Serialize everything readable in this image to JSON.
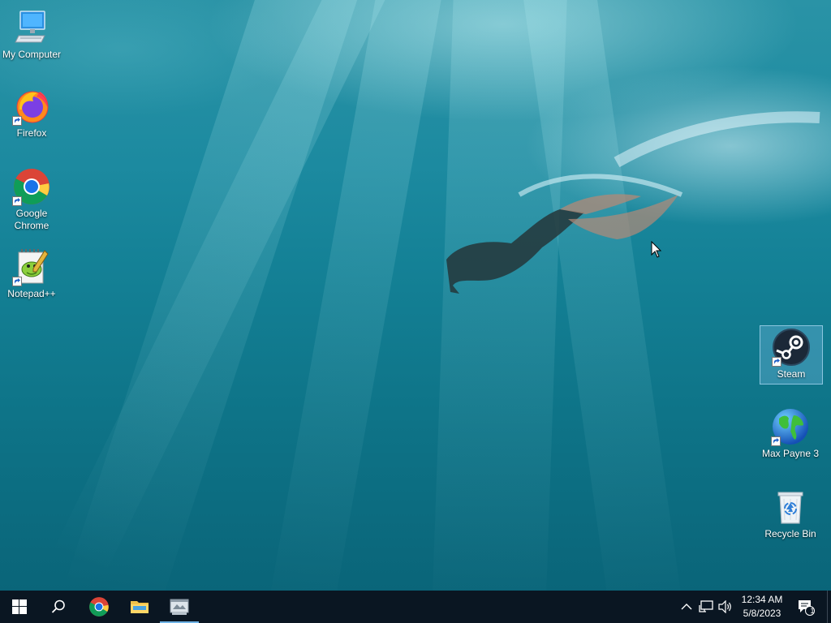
{
  "desktop": {
    "icons": [
      {
        "label": "My Computer",
        "icon": "computer-icon",
        "shortcut": false
      },
      {
        "label": "Firefox",
        "icon": "firefox-icon",
        "shortcut": true
      },
      {
        "label": "Google Chrome",
        "icon": "chrome-icon",
        "shortcut": true
      },
      {
        "label": "Notepad++",
        "icon": "notepad-plus-plus-icon",
        "shortcut": true
      },
      {
        "label": "Steam",
        "icon": "steam-icon",
        "shortcut": true,
        "selected": true
      },
      {
        "label": "Max Payne 3",
        "icon": "globe-icon",
        "shortcut": true
      },
      {
        "label": "Recycle Bin",
        "icon": "recycle-bin-icon",
        "shortcut": false
      }
    ]
  },
  "taskbar": {
    "pinned": [
      {
        "name": "start-button",
        "icon": "windows-logo-icon"
      },
      {
        "name": "search-button",
        "icon": "search-icon"
      },
      {
        "name": "chrome-taskbar-button",
        "icon": "chrome-icon"
      },
      {
        "name": "file-explorer-taskbar-button",
        "icon": "folder-icon"
      },
      {
        "name": "active-app-taskbar-button",
        "icon": "app-window-icon",
        "active": true
      }
    ],
    "tray": {
      "icons": [
        "chevron-up-icon",
        "network-icon",
        "volume-icon"
      ],
      "time": "12:34 AM",
      "date": "5/8/2023",
      "notification_count": "1"
    }
  },
  "colors": {
    "taskbar": "#0a1622",
    "active_indicator": "#6fb3e6",
    "selection": "#78bee6"
  }
}
